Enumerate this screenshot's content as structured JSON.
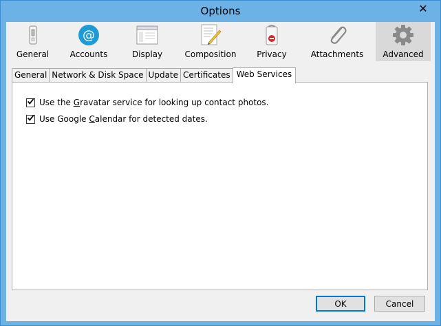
{
  "window": {
    "title": "Options"
  },
  "categories": [
    {
      "label": "General",
      "icon": "switch-icon"
    },
    {
      "label": "Accounts",
      "icon": "at-sign-icon"
    },
    {
      "label": "Display",
      "icon": "display-window-icon"
    },
    {
      "label": "Composition",
      "icon": "compose-pencil-icon"
    },
    {
      "label": "Privacy",
      "icon": "privacy-tag-icon"
    },
    {
      "label": "Attachments",
      "icon": "paperclip-icon"
    },
    {
      "label": "Advanced",
      "icon": "gear-icon",
      "selected": true
    }
  ],
  "tabs": [
    {
      "label": "General"
    },
    {
      "label": "Network & Disk Space"
    },
    {
      "label": "Update"
    },
    {
      "label": "Certificates"
    },
    {
      "label": "Web Services",
      "active": true
    }
  ],
  "options": [
    {
      "pre": "Use the ",
      "u": "G",
      "post": "ravatar service for looking up contact photos.",
      "checked": true
    },
    {
      "pre": "Use Google ",
      "u": "C",
      "post": "alendar for detected dates.",
      "checked": true
    }
  ],
  "buttons": {
    "ok": "OK",
    "cancel": "Cancel"
  },
  "colors": {
    "accent": "#0078d7",
    "titlebar": "#6cb2e6",
    "accounts_icon": "#1e9bd7"
  }
}
